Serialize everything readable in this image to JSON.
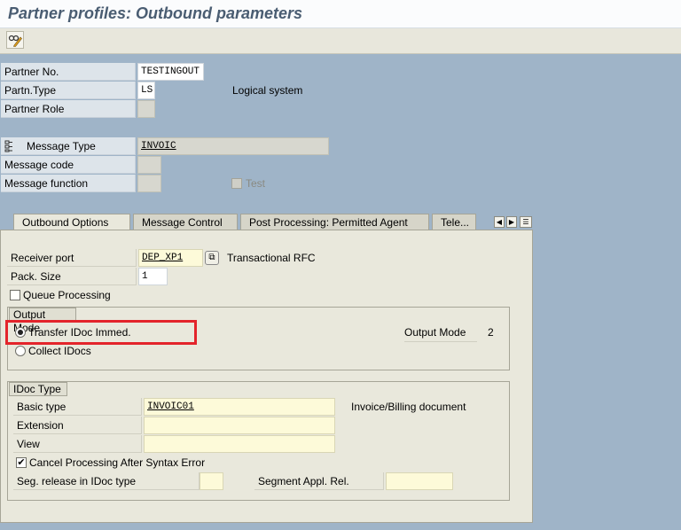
{
  "window": {
    "title": "Partner profiles: Outbound parameters"
  },
  "toolbar": {
    "edit_icon": "pencil-glasses-icon"
  },
  "partner": {
    "no_label": "Partner No.",
    "no_value": "TESTINGOUT",
    "type_label": "Partn.Type",
    "type_value": "LS",
    "type_desc": "Logical system",
    "role_label": "Partner Role",
    "role_value": ""
  },
  "message": {
    "type_label": "Message Type",
    "type_value": "INVOIC",
    "code_label": "Message code",
    "code_value": "",
    "function_label": "Message function",
    "function_value": "",
    "test_label": "Test"
  },
  "tabs": [
    "Outbound Options",
    "Message Control",
    "Post Processing: Permitted Agent",
    "Tele..."
  ],
  "outbound": {
    "receiver_port_label": "Receiver port",
    "receiver_port_value": "DEP_XP1",
    "receiver_port_desc": "Transactional RFC",
    "pack_size_label": "Pack. Size",
    "pack_size_value": "1",
    "queue_label": "Queue Processing"
  },
  "output_mode": {
    "title": "Output Mode",
    "transfer_label": "Transfer IDoc Immed.",
    "collect_label": "Collect IDocs",
    "mode_label": "Output Mode",
    "mode_value": "2"
  },
  "idoc_type": {
    "title": "IDoc Type",
    "basic_label": "Basic type",
    "basic_value": "INVOIC01",
    "basic_desc": "Invoice/Billing document",
    "extension_label": "Extension",
    "extension_value": "",
    "view_label": "View",
    "view_value": "",
    "cancel_label": "Cancel Processing After Syntax Error",
    "seg_release_label": "Seg. release in IDoc type",
    "seg_release_value": "",
    "segment_appl_label": "Segment Appl. Rel.",
    "segment_appl_value": ""
  },
  "colors": {
    "highlight": "#e3242b",
    "background": "#9fb4c8"
  }
}
